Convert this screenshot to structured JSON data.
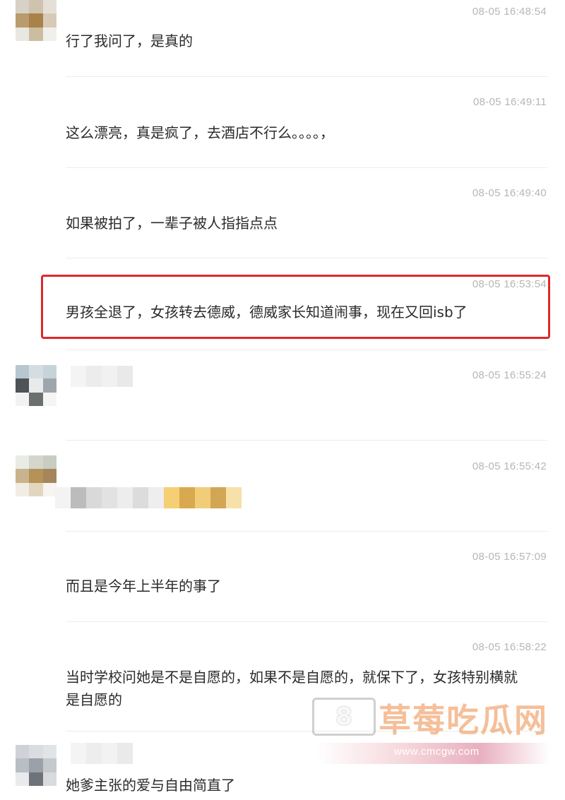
{
  "messages": [
    {
      "timestamp": "08-05 16:48:54",
      "text": "行了我问了，是真的"
    },
    {
      "timestamp": "08-05 16:49:11",
      "text": "这么漂亮，真是疯了，去酒店不行么。。。。，"
    },
    {
      "timestamp": "08-05 16:49:40",
      "text": "如果被拍了，一辈子被人指指点点"
    },
    {
      "timestamp": "08-05 16:53:54",
      "text": "男孩全退了，女孩转去德威，德威家长知道闹事，现在又回isb了"
    },
    {
      "timestamp": "08-05 16:55:24",
      "text": ""
    },
    {
      "timestamp": "08-05 16:55:42",
      "text": ""
    },
    {
      "timestamp": "08-05 16:57:09",
      "text": "而且是今年上半年的事了"
    },
    {
      "timestamp": "08-05 16:58:22",
      "text": "当时学校问她是不是自愿的，如果不是自愿的，就保下了，女孩特别横就是自愿的"
    },
    {
      "timestamp": "",
      "text": "她爹主张的爱与自由简直了"
    }
  ],
  "watermark": {
    "name": "草莓吃瓜网",
    "url": "www.cmcgw.com"
  },
  "colors": {
    "highlight": "#e0282b",
    "timestamp": "#b6b6b6",
    "text": "#2a2a2a"
  }
}
